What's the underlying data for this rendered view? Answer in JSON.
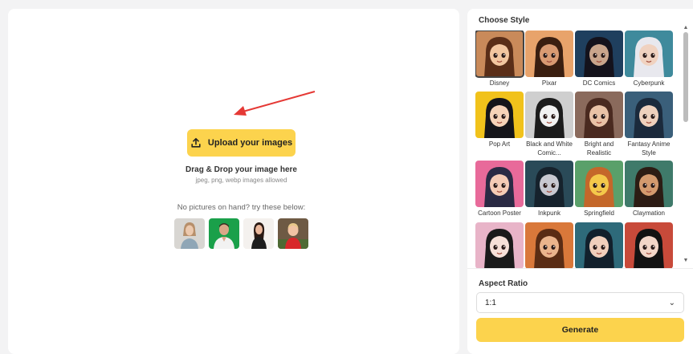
{
  "upload": {
    "button_label": "Upload your images",
    "drag_title": "Drag & Drop your image here",
    "formats": "jpeg, png, webp images allowed",
    "sample_prompt": "No pictures on hand? try these below:"
  },
  "samples": [
    {
      "name": "sample-woman"
    },
    {
      "name": "sample-man"
    },
    {
      "name": "sample-girl"
    },
    {
      "name": "sample-child"
    }
  ],
  "style_panel": {
    "title": "Choose Style",
    "selected": "Disney",
    "styles": [
      {
        "label": "Disney",
        "bg": "#c98a5a",
        "hair": "#5a2e18",
        "skin": "#f2c6a0"
      },
      {
        "label": "Pixar",
        "bg": "#e8a36b",
        "hair": "#3a1e10",
        "skin": "#d99a72"
      },
      {
        "label": "DC Comics",
        "bg": "#1f3f5e",
        "hair": "#14121c",
        "skin": "#c9a58c"
      },
      {
        "label": "Cyberpunk",
        "bg": "#3f8a9c",
        "hair": "#e8e8ee",
        "skin": "#f0d2c0"
      },
      {
        "label": "Pop Art",
        "bg": "#f1c21b",
        "hair": "#15151a",
        "skin": "#f6d3b8"
      },
      {
        "label": "Black and White Comic...",
        "bg": "#cfcfcf",
        "hair": "#1c1c1c",
        "skin": "#f2f2f2"
      },
      {
        "label": "Bright and Realistic",
        "bg": "#8a6a5c",
        "hair": "#4a2a20",
        "skin": "#e9c2a6"
      },
      {
        "label": "Fantasy Anime Style",
        "bg": "#3a5f7a",
        "hair": "#1b2a3c",
        "skin": "#efd1bd"
      },
      {
        "label": "Cartoon Poster",
        "bg": "#e86a9a",
        "hair": "#2a2a44",
        "skin": "#f5cbb5"
      },
      {
        "label": "Inkpunk",
        "bg": "#2a4a58",
        "hair": "#16222c",
        "skin": "#c8c8d0"
      },
      {
        "label": "Springfield",
        "bg": "#5aa06a",
        "hair": "#c4672a",
        "skin": "#f4c84a"
      },
      {
        "label": "Claymation",
        "bg": "#3f7a6a",
        "hair": "#2c1c14",
        "skin": "#d39a6e"
      },
      {
        "label": "",
        "bg": "#e8b4c8",
        "hair": "#1a1a1a",
        "skin": "#f6e0d8"
      },
      {
        "label": "",
        "bg": "#d9783a",
        "hair": "#5a2c14",
        "skin": "#eab48c"
      },
      {
        "label": "",
        "bg": "#2e6a7a",
        "hair": "#12202c",
        "skin": "#f0cfbc"
      },
      {
        "label": "",
        "bg": "#c84a3a",
        "hair": "#121212",
        "skin": "#f2d6c8"
      }
    ]
  },
  "aspect_ratio": {
    "title": "Aspect Ratio",
    "value": "1:1"
  },
  "generate": {
    "label": "Generate"
  },
  "colors": {
    "accent": "#fcd34d",
    "arrow": "#e53935"
  }
}
